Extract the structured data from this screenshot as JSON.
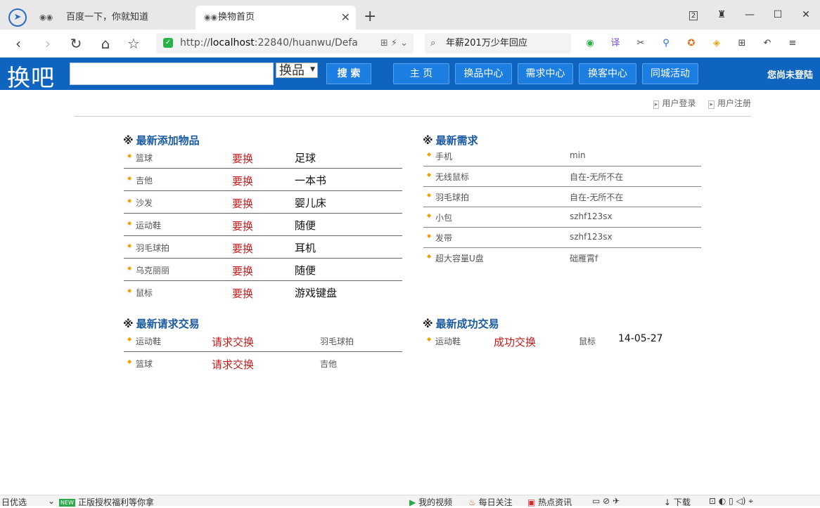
{
  "browser": {
    "tabs": [
      {
        "title": "百度一下，你就知道",
        "active": false
      },
      {
        "title": "换物首页",
        "active": true
      }
    ],
    "tab_counter": "2",
    "url_prefix": "http://",
    "url_host": "localhost",
    "url_rest": ":22840/huanwu/Defa",
    "search_text": "年薪201万少年回应"
  },
  "site": {
    "logo": "换吧",
    "search_placeholder": "",
    "category": "换品",
    "search_button": "搜 索",
    "nav": [
      "主 页",
      "换品中心",
      "需求中心",
      "换客中心",
      "同城活动"
    ],
    "login_status": "您尚未登陆",
    "user_links": [
      "用户登录",
      "用户注册"
    ]
  },
  "sections": {
    "new_items": {
      "title": "最新添加物品",
      "rows": [
        {
          "name": "篮球",
          "action": "要换",
          "target": "足球"
        },
        {
          "name": "吉他",
          "action": "要换",
          "target": "一本书"
        },
        {
          "name": "沙发",
          "action": "要换",
          "target": "婴儿床"
        },
        {
          "name": "运动鞋",
          "action": "要换",
          "target": "随便"
        },
        {
          "name": "羽毛球拍",
          "action": "要换",
          "target": "耳机"
        },
        {
          "name": "乌克丽丽",
          "action": "要换",
          "target": "随便"
        },
        {
          "name": "鼠标",
          "action": "要换",
          "target": "游戏键盘"
        }
      ]
    },
    "demands": {
      "title": "最新需求",
      "rows": [
        {
          "name": "手机",
          "user": "min"
        },
        {
          "name": "无线鼠标",
          "user": "自在-无所不在"
        },
        {
          "name": "羽毛球拍",
          "user": "自在-无所不在"
        },
        {
          "name": "小包",
          "user": "szhf123sx"
        },
        {
          "name": "发带",
          "user": "szhf123sx"
        },
        {
          "name": "超大容量U盘",
          "user": "础雁霄f"
        }
      ]
    },
    "requests": {
      "title": "最新请求交易",
      "rows": [
        {
          "name": "运动鞋",
          "action": "请求交换",
          "user": "羽毛球拍"
        },
        {
          "name": "篮球",
          "action": "请求交换",
          "user": "吉他"
        }
      ]
    },
    "success": {
      "title": "最新成功交易",
      "rows": [
        {
          "name": "运动鞋",
          "action": "成功交换",
          "user": "鼠标",
          "date": "14-05-27"
        }
      ]
    }
  },
  "statusbar": {
    "left1": "日优选",
    "new_badge": "NEW",
    "left2": "正版授权福利等你拿",
    "right": [
      "我的视频",
      "每日关注",
      "热点资讯",
      "下载"
    ]
  }
}
